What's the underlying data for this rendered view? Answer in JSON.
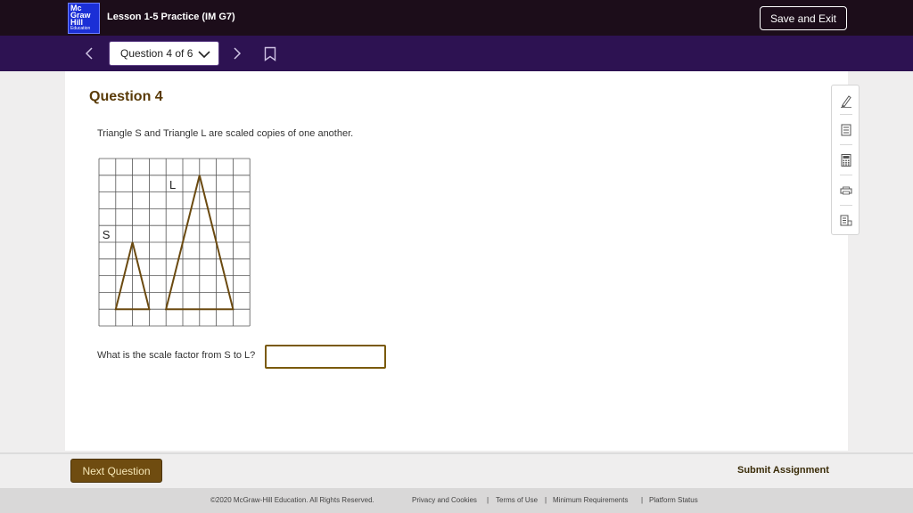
{
  "header": {
    "logo_lines": [
      "Mc",
      "Graw",
      "Hill"
    ],
    "logo_sub": "Education",
    "lesson_title": "Lesson 1-5 Practice (IM G7)",
    "save_exit_label": "Save and Exit"
  },
  "nav": {
    "question_selector": "Question 4 of 6"
  },
  "question": {
    "heading": "Question 4",
    "prompt": "Triangle S and Triangle L are scaled copies of one another.",
    "label_s": "S",
    "label_l": "L",
    "scale_question": "What is the scale factor from S to L?",
    "answer_value": "",
    "grid": {
      "columns": 9,
      "rows": 10
    },
    "triangle_s": {
      "base_units": 2,
      "height_units": 4
    },
    "triangle_l": {
      "base_units": 4,
      "height_units": 8
    },
    "triangle_color": "#6b4a10"
  },
  "tools": [
    "pencil-icon",
    "notepad-icon",
    "calculator-icon",
    "print-icon",
    "reference-icon"
  ],
  "footer": {
    "next_label": "Next Question",
    "submit_label": "Submit Assignment"
  },
  "legal": {
    "copyright": "©2020 McGraw-Hill Education. All Rights Reserved.",
    "privacy": "Privacy and Cookies",
    "terms": "Terms of Use",
    "requirements": "Minimum Requirements",
    "status": "Platform Status"
  }
}
